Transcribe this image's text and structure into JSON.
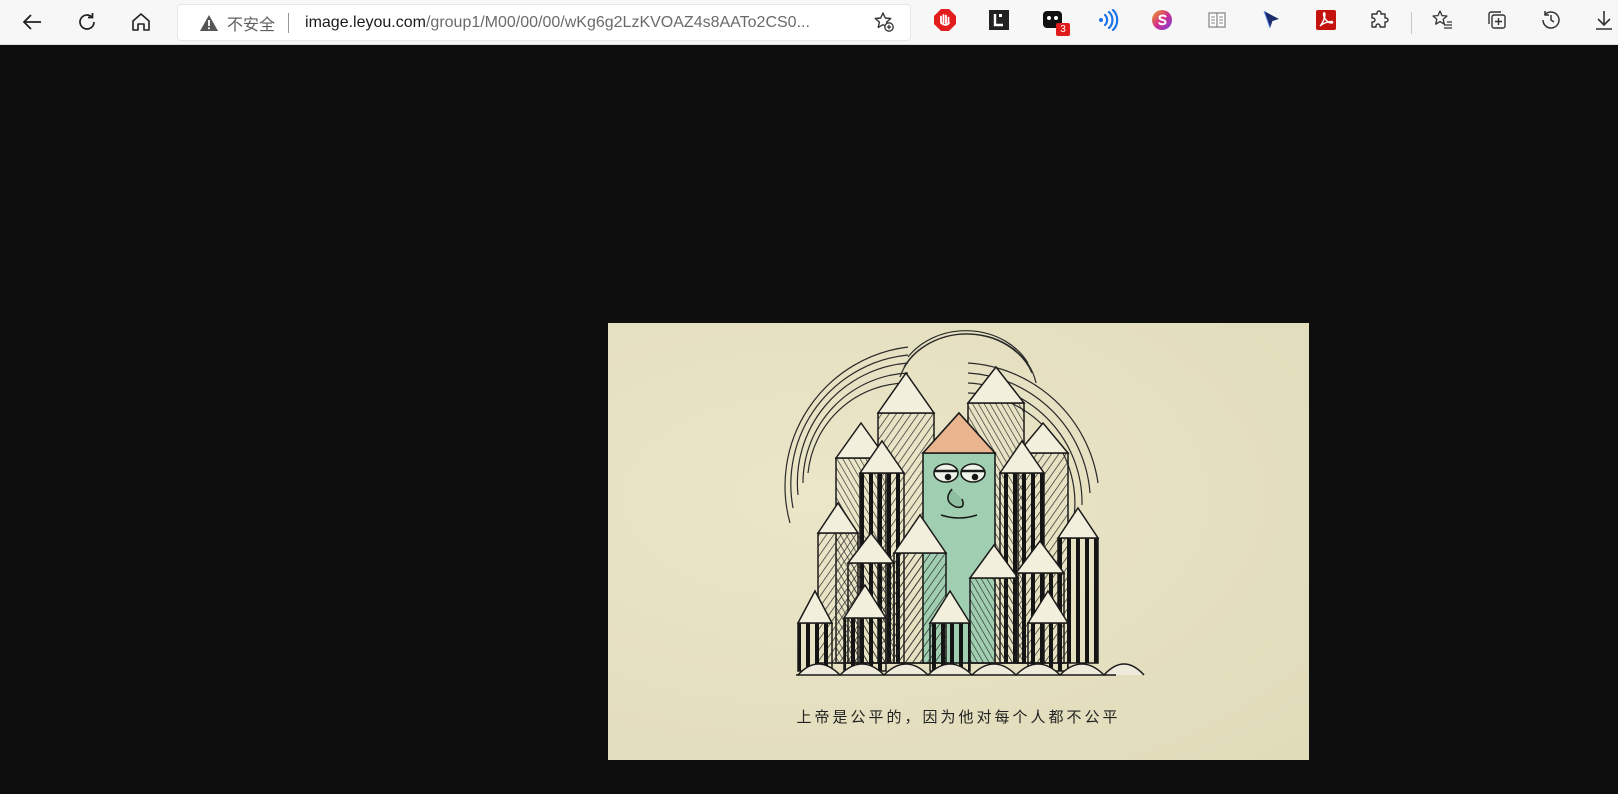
{
  "toolbar": {
    "back_icon": "arrow-left-icon",
    "refresh_icon": "refresh-icon",
    "home_icon": "home-icon",
    "address": {
      "security_label": "不安全",
      "url_host": "image.leyou.com",
      "url_path": "/group1/M00/00/00/wKg6g2LzKVOAZ4s8AATo2CS0..."
    },
    "extensions": [
      {
        "name": "adblock-icon",
        "color": "#e11d1d"
      },
      {
        "name": "letterbox-icon",
        "color": "#222222"
      },
      {
        "name": "puzzle-ext-icon",
        "color": "#111111",
        "badge": "3"
      },
      {
        "name": "audio-wave-icon",
        "color": "#1a73e8"
      },
      {
        "name": "s-logo-icon",
        "color": "#c13bd6"
      },
      {
        "name": "reader-icon",
        "color": "#8a8a8a"
      },
      {
        "name": "cursor-icon",
        "color": "#1c2b6b"
      },
      {
        "name": "pdf-icon",
        "color": "#c4120f"
      },
      {
        "name": "extensions-icon",
        "color": "#333333"
      }
    ],
    "right_icons": [
      "favorites-icon",
      "collections-icon",
      "history-icon",
      "downloads-icon"
    ]
  },
  "image": {
    "caption": "上帝是公平的，因为他对每个人都不公平",
    "accent_face": "#9fcfb0",
    "accent_tip": "#e9b48e"
  }
}
